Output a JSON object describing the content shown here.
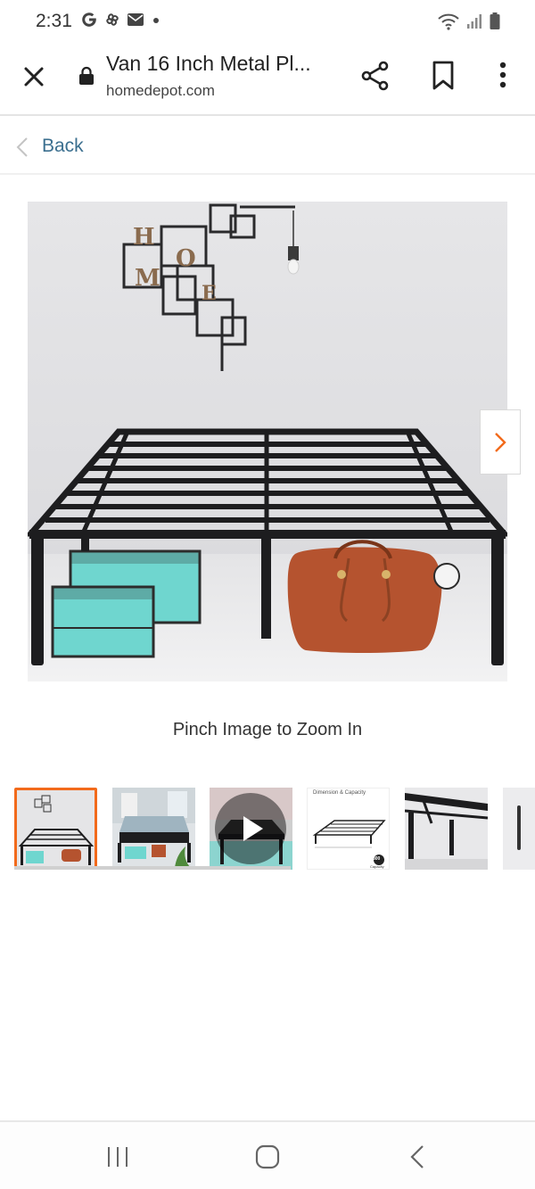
{
  "status_bar": {
    "time": "2:31",
    "left_icons": [
      "google-g-icon",
      "pinwheel-icon",
      "mail-icon",
      "dot-icon"
    ],
    "right_icons": [
      "wifi-icon",
      "signal-icon",
      "battery-icon"
    ]
  },
  "toolbar": {
    "page_title": "Van 16 Inch Metal Pl...",
    "domain": "homedepot.com",
    "icons": [
      "close-icon",
      "lock-icon",
      "share-icon",
      "bookmark-icon",
      "more-vertical-icon"
    ]
  },
  "back": {
    "label": "Back"
  },
  "gallery": {
    "pinch_hint": "Pinch Image to Zoom In",
    "selected_index": 0,
    "thumb_scroll_progress": 0.53,
    "thumbnail_5_label_top": "Dimension & Capacity",
    "thumbnail_5_badge": "800",
    "thumbnail_5_badge_sub": "Capacity"
  },
  "colors": {
    "accent_orange": "#f26a1b",
    "link_blue": "#3b6f8f",
    "teal_box": "#6fd6cf",
    "leather_bag": "#b5532f",
    "frame_black": "#1d1d1f"
  },
  "nav_bar": {
    "icons": [
      "recents-icon",
      "home-icon",
      "back-icon"
    ]
  }
}
